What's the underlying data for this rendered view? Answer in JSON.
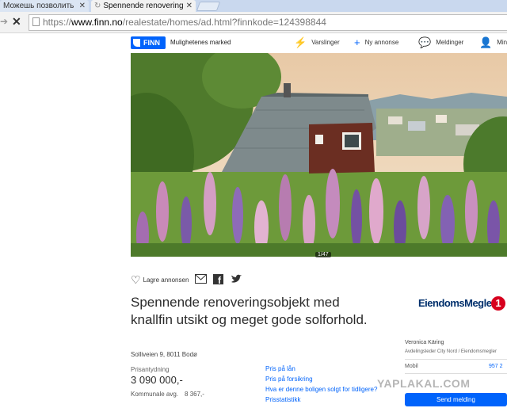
{
  "browser": {
    "tabs": [
      {
        "label": "Можешь позволить",
        "close": "✕"
      },
      {
        "label": "Spennende renovering",
        "close": "✕"
      }
    ],
    "url": {
      "scheme": "https://",
      "host": "www.finn.no",
      "path": "/realestate/homes/ad.html?finnkode=124398844"
    },
    "back_icon": "back-arrow-icon",
    "stop_icon": "stop-x-icon"
  },
  "header": {
    "logo": "FINN",
    "tagline": "Mulighetenes marked",
    "nav": [
      {
        "label": "Varslinger",
        "icon": "bolt-icon"
      },
      {
        "label": "Ny annonse",
        "icon": "plus-icon"
      },
      {
        "label": "Meldinger",
        "icon": "chat-icon"
      },
      {
        "label": "Min",
        "icon": "user-icon"
      }
    ]
  },
  "listing": {
    "photo_counter": "1/47",
    "save_label": "Lagre annonsen",
    "title": "Spennende renoveringsobjekt med knallfin utsikt og meget gode solforhold.",
    "address": "Solliveien 9, 8011 Bodø",
    "price_label": "Prisantydning",
    "price": "3 090 000,-",
    "municipal_label": "Kommunale avg.",
    "municipal_value": "8 367,-",
    "links": [
      "Pris på lån",
      "Pris på forsikring",
      "Hva er denne boligen solgt for tidligere?",
      "Prisstatistikk"
    ]
  },
  "agent": {
    "broker_name": "EiendomsMegler",
    "broker_number": "1",
    "name": "Veronica Käring",
    "role": "Avdelingsleder City Nord / Eiendomsmegler",
    "mobile_label": "Mobil",
    "mobile_number": "957 2",
    "send_label": "Send melding"
  },
  "watermark": "YAPLAKAL.COM",
  "colors": {
    "finn_blue": "#0063fb",
    "broker_red": "#d7001e",
    "broker_navy": "#002f6c"
  }
}
